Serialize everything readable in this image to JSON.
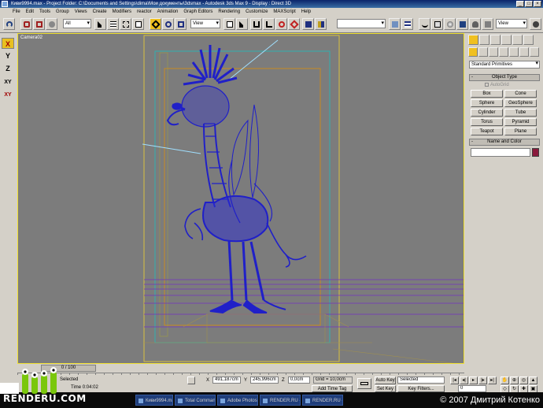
{
  "window": {
    "title": "Киви9994.max  -  Project Folder: C:\\Documents and Settings\\dima\\Мои документы\\3dsmax   -  Autodesk 3ds Max 9   -  Display : Direct 3D"
  },
  "menu": [
    "File",
    "Edit",
    "Tools",
    "Group",
    "Views",
    "Create",
    "Modifiers",
    "reactor",
    "Animation",
    "Graph Editors",
    "Rendering",
    "Customize",
    "MAXScript",
    "Help"
  ],
  "toolbar": {
    "selection_filter": "All",
    "ref_coord": "View",
    "named_selection": "",
    "render_view": "View"
  },
  "axis_constraints": [
    "X",
    "Y",
    "Z",
    "XY",
    "XY"
  ],
  "viewport": {
    "label": "Camera02",
    "background_color": "#7c7c7c",
    "wire_color": "#2020c8",
    "safe_frame_color": "#d8c040"
  },
  "command_panel": {
    "category": "Standard Primitives",
    "object_type_header": "Object Type",
    "autogrid": "AutoGrid",
    "objects": [
      "Box",
      "Cone",
      "Sphere",
      "GeoSphere",
      "Cylinder",
      "Tube",
      "Torus",
      "Pyramid",
      "Teapot",
      "Plane"
    ],
    "name_color_header": "Name and Color",
    "object_color": "#8a1a3c"
  },
  "timeline": {
    "frame": "0 / 100"
  },
  "status": {
    "selection": "Selected",
    "x_label": "X",
    "x_value": "491,187cm",
    "y_label": "Y",
    "y_value": "245,996cm",
    "z_label": "Z",
    "z_value": "0,0cm",
    "grid": "Grid = 10,0cm",
    "render_time": "Time  0:04:02",
    "add_time_tag": "Add Time Tag",
    "auto_key": "Auto Key",
    "set_key": "Set Key",
    "key_mode": "Selected",
    "key_filters": "Key Filters...",
    "current_frame": "0"
  },
  "taskbar": {
    "items": [
      "Киви9994.max",
      "Total Commander",
      "Adobe Photosh...",
      "RENDER.RU - ...",
      "RENDER.RU - ..."
    ],
    "copyright": "© 2007 Дмитрий Котенко"
  },
  "logo": {
    "text": "RENDERU.COM"
  }
}
